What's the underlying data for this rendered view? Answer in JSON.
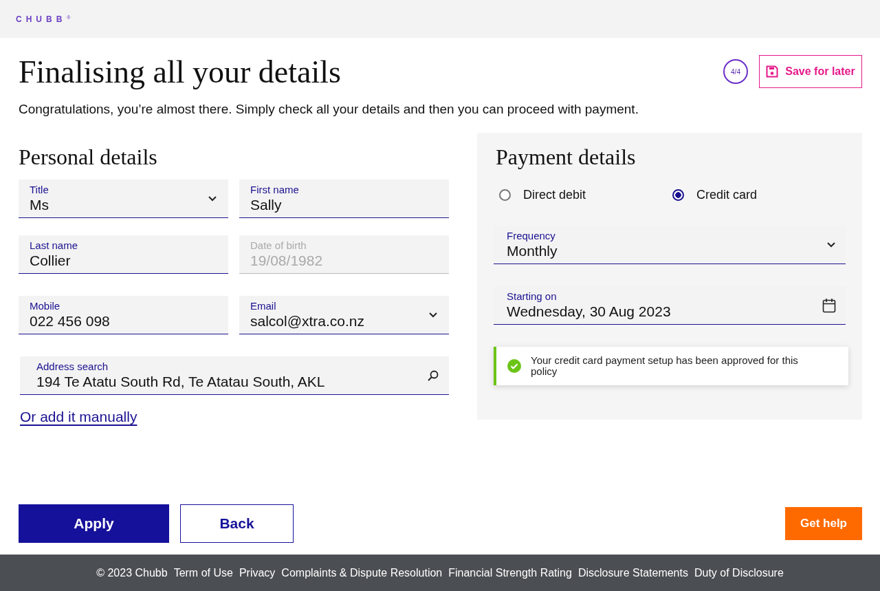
{
  "header": {
    "logo": "CHUBB",
    "logo_mark": "®"
  },
  "page": {
    "title": "Finalising all your details",
    "step": "4/4",
    "save_button": "Save for later",
    "intro": "Congratulations, you’re almost there. Simply check all your details and then you can proceed with payment."
  },
  "personal": {
    "heading": "Personal details",
    "fields": [
      {
        "label": "Title",
        "value": "Ms",
        "kind": "select",
        "disabled": false
      },
      {
        "label": "First name",
        "value": "Sally",
        "kind": "text",
        "disabled": false
      },
      {
        "label": "Last name",
        "value": "Collier",
        "kind": "text",
        "disabled": false
      },
      {
        "label": "Date of birth",
        "value": "19/08/1982",
        "kind": "text",
        "disabled": true
      },
      {
        "label": "Mobile",
        "value": "022 456 098",
        "kind": "text",
        "disabled": false
      },
      {
        "label": "Email",
        "value": "salcol@xtra.co.nz",
        "kind": "select",
        "disabled": false
      }
    ],
    "address": {
      "label": "Address search",
      "value": "194 Te Atatu South Rd, Te Atatau South, AKL"
    },
    "manual_link": "Or add it manually"
  },
  "payment": {
    "heading": "Payment details",
    "options": [
      {
        "label": "Direct debit",
        "selected": false
      },
      {
        "label": "Credit card",
        "selected": true
      }
    ],
    "fields": [
      {
        "label": "Frequency",
        "value": "Monthly",
        "kind": "select"
      },
      {
        "label": "Starting on",
        "value": "Wednesday, 30 Aug 2023",
        "kind": "date"
      }
    ],
    "notice": "Your credit card payment setup has been approved for this policy"
  },
  "actions": {
    "apply": "Apply",
    "back": "Back",
    "help": "Get help"
  },
  "footer": {
    "links": [
      "© 2023 Chubb",
      "Term of Use",
      "Privacy",
      "Complaints & Dispute Resolution",
      "Financial Strength Rating",
      "Disclosure Statements",
      "Duty of Disclosure"
    ]
  }
}
